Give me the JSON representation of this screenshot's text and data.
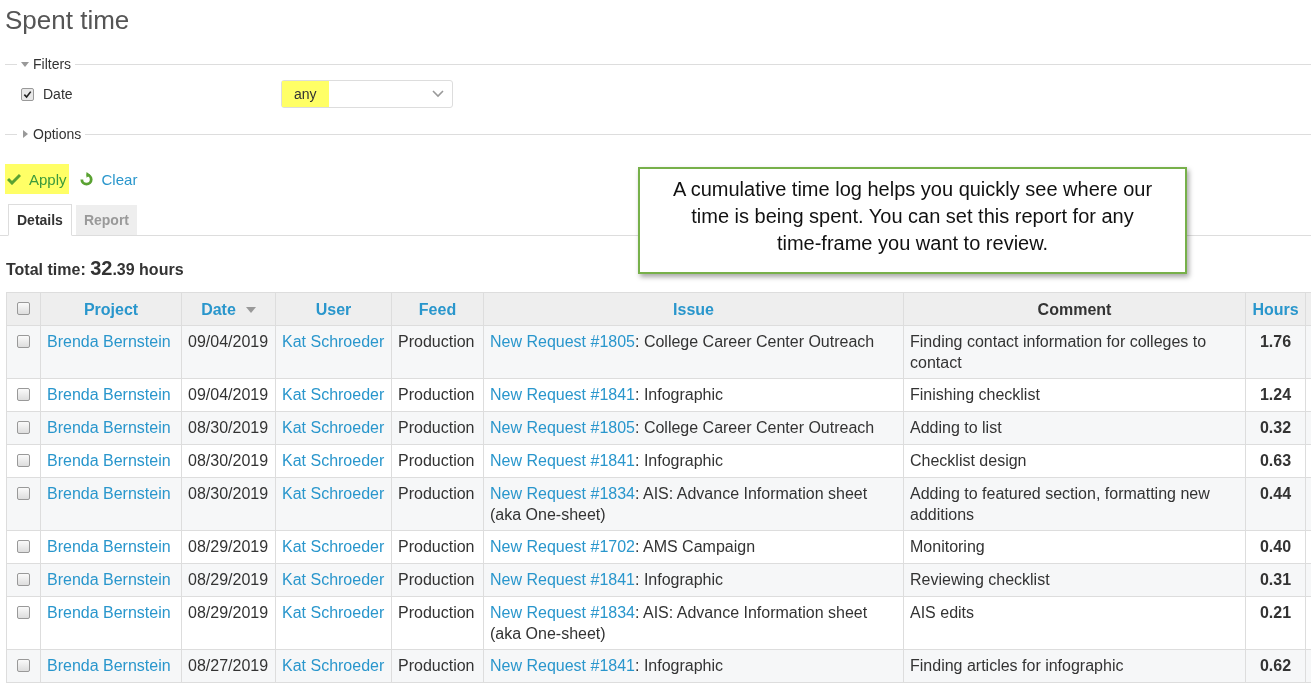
{
  "page": {
    "title": "Spent time"
  },
  "filters": {
    "legend": "Filters",
    "expanded": true,
    "items": [
      {
        "label": "Date",
        "checked": true,
        "value": "any",
        "highlighted": true
      }
    ]
  },
  "options": {
    "legend": "Options",
    "expanded": false
  },
  "actions": [
    {
      "kind": "apply",
      "label": "Apply",
      "highlighted": true
    },
    {
      "kind": "clear",
      "label": "Clear",
      "highlighted": false
    }
  ],
  "callout": {
    "text": "A cumulative time log helps you quickly see where our time is being spent. You can set this report for any time-frame you want to review."
  },
  "tabs": [
    {
      "label": "Details",
      "selected": true
    },
    {
      "label": "Report",
      "selected": false
    }
  ],
  "total": {
    "label": "Total time:",
    "whole": "32",
    "fraction": ".39",
    "unit": "hours"
  },
  "table": {
    "select_all_checked": false,
    "columns": [
      {
        "label": "Project",
        "kind": "link",
        "sorted": false
      },
      {
        "label": "Date",
        "kind": "link",
        "sorted": true
      },
      {
        "label": "User",
        "kind": "link",
        "sorted": false
      },
      {
        "label": "Feed",
        "kind": "link",
        "sorted": false
      },
      {
        "label": "Issue",
        "kind": "link",
        "sorted": false
      },
      {
        "label": "Comment",
        "kind": "plain",
        "sorted": false
      },
      {
        "label": "Hours",
        "kind": "link",
        "sorted": false
      }
    ],
    "rows": [
      {
        "checked": false,
        "project": "Brenda Bernstein",
        "date": "09/04/2019",
        "user": "Kat Schroeder",
        "feed": "Production",
        "issue_link": "New Request #1805",
        "issue_title": ": College Career Center Outreach",
        "comment": "Finding contact information for colleges to contact",
        "hours": "1.76"
      },
      {
        "checked": false,
        "project": "Brenda Bernstein",
        "date": "09/04/2019",
        "user": "Kat Schroeder",
        "feed": "Production",
        "issue_link": "New Request #1841",
        "issue_title": ": Infographic",
        "comment": "Finishing checklist",
        "hours": "1.24"
      },
      {
        "checked": false,
        "project": "Brenda Bernstein",
        "date": "08/30/2019",
        "user": "Kat Schroeder",
        "feed": "Production",
        "issue_link": "New Request #1805",
        "issue_title": ": College Career Center Outreach",
        "comment": "Adding to list",
        "hours": "0.32"
      },
      {
        "checked": false,
        "project": "Brenda Bernstein",
        "date": "08/30/2019",
        "user": "Kat Schroeder",
        "feed": "Production",
        "issue_link": "New Request #1841",
        "issue_title": ": Infographic",
        "comment": "Checklist design",
        "hours": "0.63"
      },
      {
        "checked": false,
        "project": "Brenda Bernstein",
        "date": "08/30/2019",
        "user": "Kat Schroeder",
        "feed": "Production",
        "issue_link": "New Request #1834",
        "issue_title": ": AIS: Advance Information sheet (aka One-sheet)",
        "comment": "Adding to featured section, formatting new additions",
        "hours": "0.44"
      },
      {
        "checked": false,
        "project": "Brenda Bernstein",
        "date": "08/29/2019",
        "user": "Kat Schroeder",
        "feed": "Production",
        "issue_link": "New Request #1702",
        "issue_title": ": AMS Campaign",
        "comment": "Monitoring",
        "hours": "0.40"
      },
      {
        "checked": false,
        "project": "Brenda Bernstein",
        "date": "08/29/2019",
        "user": "Kat Schroeder",
        "feed": "Production",
        "issue_link": "New Request #1841",
        "issue_title": ": Infographic",
        "comment": "Reviewing checklist",
        "hours": "0.31"
      },
      {
        "checked": false,
        "project": "Brenda Bernstein",
        "date": "08/29/2019",
        "user": "Kat Schroeder",
        "feed": "Production",
        "issue_link": "New Request #1834",
        "issue_title": ": AIS: Advance Information sheet (aka One-sheet)",
        "comment": "AIS edits",
        "hours": "0.21"
      },
      {
        "checked": false,
        "project": "Brenda Bernstein",
        "date": "08/27/2019",
        "user": "Kat Schroeder",
        "feed": "Production",
        "issue_link": "New Request #1841",
        "issue_title": ": Infographic",
        "comment": "Finding articles for infographic",
        "hours": "0.62"
      }
    ]
  }
}
